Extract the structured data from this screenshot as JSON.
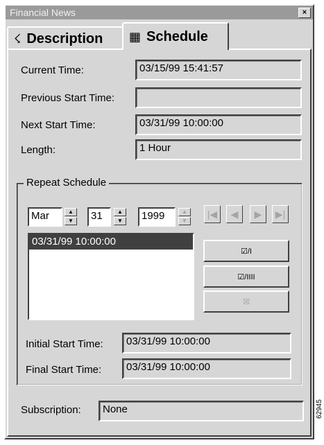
{
  "window": {
    "title": "Financial News",
    "close_glyph": "×"
  },
  "tabs": [
    {
      "label": "Description",
      "icon": "satellite-dish-icon",
      "glyph": "☇"
    },
    {
      "label": "Schedule",
      "icon": "calendar-icon",
      "glyph": "▦"
    }
  ],
  "fields": {
    "current_time": {
      "label": "Current Time:",
      "value": "03/15/99 15:41:57"
    },
    "previous_start": {
      "label": "Previous Start Time:",
      "value": ""
    },
    "next_start": {
      "label": "Next Start Time:",
      "value": "03/31/99 10:00:00"
    },
    "length": {
      "label": "Length:",
      "value": "1 Hour"
    }
  },
  "repeat": {
    "legend": "Repeat Schedule",
    "month": "Mar",
    "day": "31",
    "year": "1999",
    "spin_up": "▲",
    "spin_down": "▼",
    "nav": {
      "first": "|◀",
      "prev": "◀",
      "next": "▶",
      "last": "▶|"
    },
    "list_items": [
      "03/31/99 10:00:00"
    ],
    "buttons": {
      "add_one": "☑/I",
      "add_many": "☑/IIII",
      "remove": "☒"
    },
    "initial_start": {
      "label": "Initial Start Time:",
      "value": "03/31/99 10:00:00"
    },
    "final_start": {
      "label": "Final Start Time:",
      "value": "03/31/99 10:00:00"
    }
  },
  "subscription": {
    "label": "Subscription:",
    "value": "None"
  },
  "side_code": "62945"
}
